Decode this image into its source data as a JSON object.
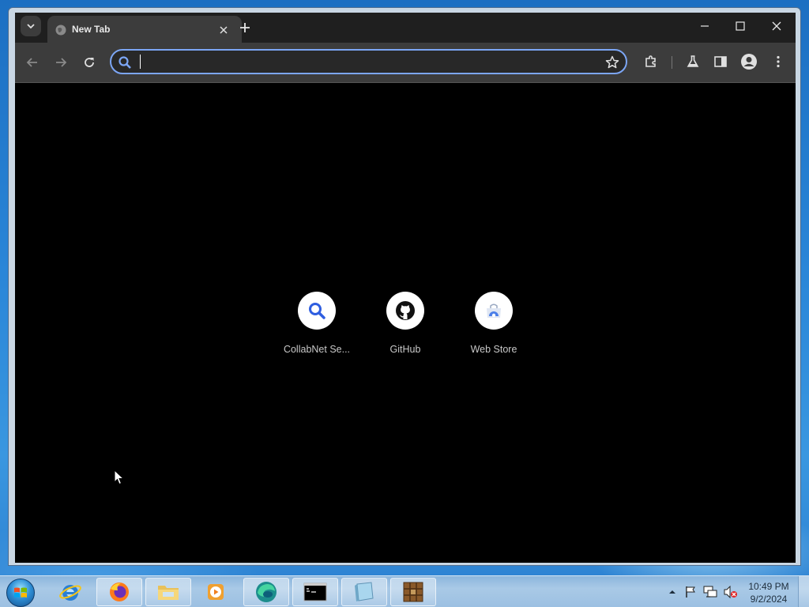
{
  "browser": {
    "tab": {
      "title": "New Tab"
    },
    "omnibox": {
      "value": "",
      "placeholder": ""
    },
    "shortcuts": [
      {
        "label": "CollabNet Se...",
        "icon": "search-icon"
      },
      {
        "label": "GitHub",
        "icon": "github-icon"
      },
      {
        "label": "Web Store",
        "icon": "webstore-icon"
      }
    ]
  },
  "taskbar": {
    "apps": [
      {
        "name": "internet-explorer-icon"
      },
      {
        "name": "firefox-icon"
      },
      {
        "name": "file-explorer-icon"
      },
      {
        "name": "media-player-icon"
      },
      {
        "name": "edge-icon"
      },
      {
        "name": "command-prompt-icon"
      },
      {
        "name": "notepad-icon"
      },
      {
        "name": "archive-icon"
      }
    ],
    "clock": {
      "time": "10:49 PM",
      "date": "9/2/2024"
    }
  },
  "colors": {
    "omnibox_border": "#7ca6f5",
    "tab_bg": "#3c3c3c",
    "toolbar_bg": "#3c3c3c",
    "page_bg": "#000000"
  }
}
